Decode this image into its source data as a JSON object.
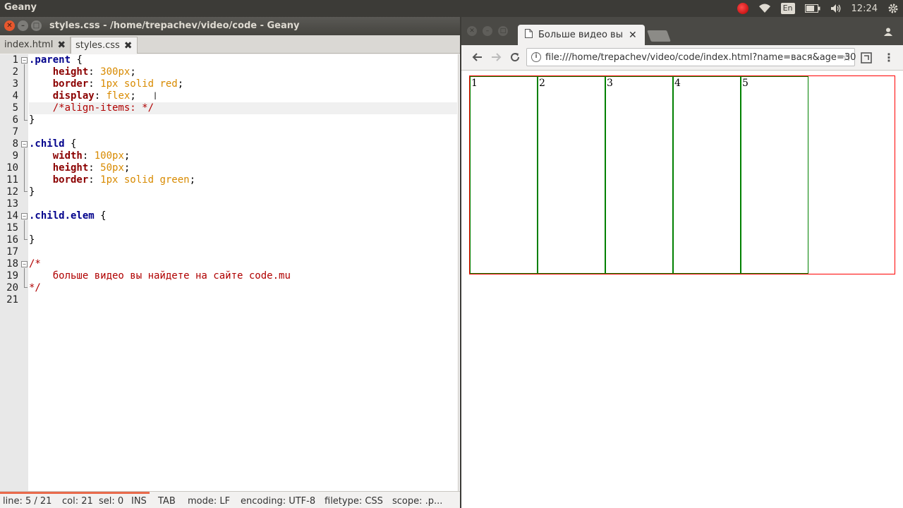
{
  "top_panel": {
    "app_name": "Geany",
    "lang": "En",
    "time": "12:24"
  },
  "geany": {
    "title": "styles.css - /home/trepachev/video/code - Geany",
    "tabs": [
      {
        "label": "index.html",
        "active": false
      },
      {
        "label": "styles.css",
        "active": true
      }
    ],
    "line_numbers": [
      "1",
      "2",
      "3",
      "4",
      "5",
      "6",
      "7",
      "8",
      "9",
      "10",
      "11",
      "12",
      "13",
      "14",
      "15",
      "16",
      "17",
      "18",
      "19",
      "20",
      "21"
    ],
    "code": {
      "l1_sel": ".parent",
      "l1_punc": " {",
      "l2_prop": "height",
      "l2_colon": ": ",
      "l2_val": "300px",
      "l2_end": ";",
      "l3_prop": "border",
      "l3_colon": ": ",
      "l3_val": "1px solid red",
      "l3_end": ";",
      "l4_prop": "display",
      "l4_colon": ": ",
      "l4_val": "flex",
      "l4_end": ";",
      "l5_cmt": "/*align-items: */",
      "l6_punc": "}",
      "l8_sel": ".child",
      "l8_punc": " {",
      "l9_prop": "width",
      "l9_colon": ": ",
      "l9_val": "100px",
      "l9_end": ";",
      "l10_prop": "height",
      "l10_colon": ": ",
      "l10_val": "50px",
      "l10_end": ";",
      "l11_prop": "border",
      "l11_colon": ": ",
      "l11_val": "1px solid green",
      "l11_end": ";",
      "l12_punc": "}",
      "l14_sel": ".child.elem",
      "l14_punc": " {",
      "l16_punc": "}",
      "l18_cmt": "/*",
      "l19_cmt": "больше видео вы найдете на сайте code.mu",
      "l20_cmt": "*/"
    },
    "status": {
      "line": "line: 5 / 21",
      "col": "col: 21",
      "sel": "sel: 0",
      "ins": "INS",
      "tab": "TAB",
      "mode": "mode: LF",
      "encoding": "encoding: UTF-8",
      "filetype": "filetype: CSS",
      "scope": "scope: .p..."
    }
  },
  "browser": {
    "tab_title": "Больше видео вы н",
    "url": "file:///home/trepachev/video/code/index.html?name=вася&age=30",
    "children": [
      "1",
      "2",
      "3",
      "4",
      "5"
    ]
  },
  "colors": {
    "parent_border": "#ff0000",
    "child_border": "#008000",
    "accent": "#e96a4b"
  }
}
